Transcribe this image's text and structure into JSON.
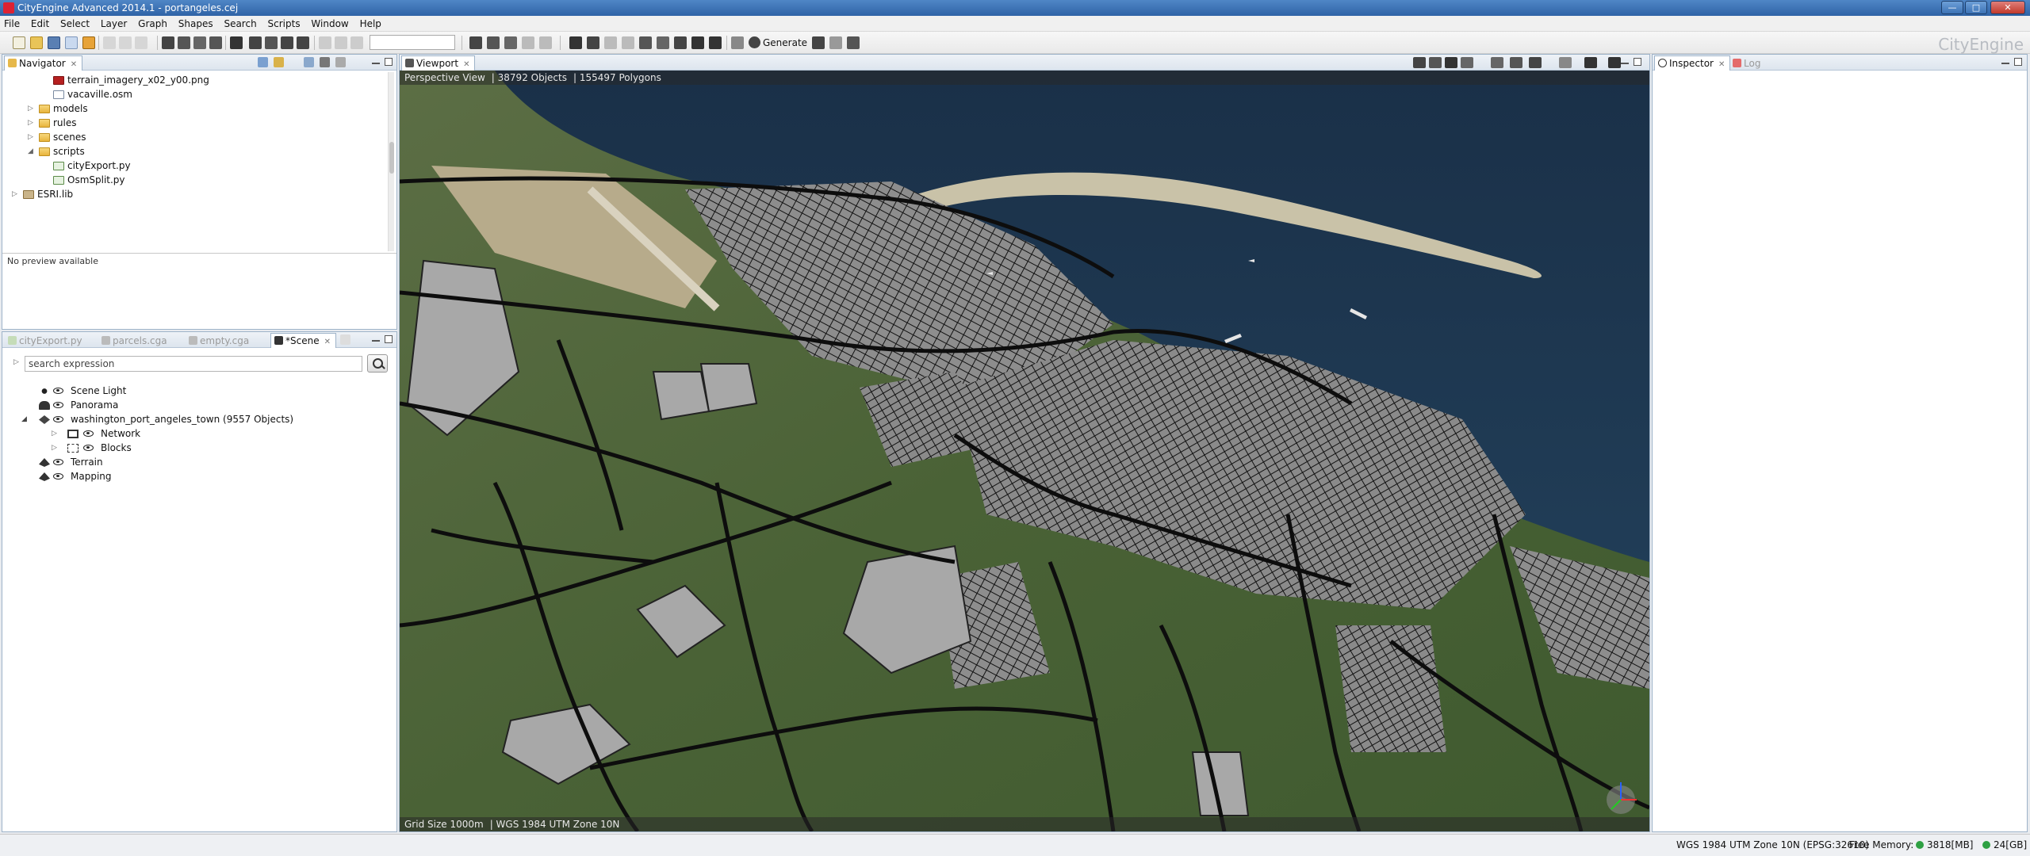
{
  "window": {
    "title": "CityEngine Advanced 2014.1 - portangeles.cej"
  },
  "menu": [
    "File",
    "Edit",
    "Select",
    "Layer",
    "Graph",
    "Shapes",
    "Search",
    "Scripts",
    "Window",
    "Help"
  ],
  "toolbar": {
    "generate_label": "Generate",
    "brand": "CityEngine"
  },
  "navigator": {
    "tab_label": "Navigator",
    "items": [
      {
        "label": "terrain_imagery_x02_y00.png",
        "icon": "image-file-icon"
      },
      {
        "label": "vacaville.osm",
        "icon": "osm-file-icon"
      },
      {
        "label": "models",
        "icon": "folder-icon"
      },
      {
        "label": "rules",
        "icon": "folder-icon"
      },
      {
        "label": "scenes",
        "icon": "folder-icon"
      },
      {
        "label": "scripts",
        "icon": "folder-icon"
      },
      {
        "label": "cityExport.py",
        "icon": "python-file-icon"
      },
      {
        "label": "OsmSplit.py",
        "icon": "python-file-icon"
      },
      {
        "label": "ESRI.lib",
        "icon": "library-icon"
      }
    ],
    "preview_text": "No preview available"
  },
  "editor_tabs": [
    {
      "label": "cityExport.py",
      "active": false
    },
    {
      "label": "parcels.cga",
      "active": false
    },
    {
      "label": "empty.cga",
      "active": false
    },
    {
      "label": "*Scene",
      "active": true
    }
  ],
  "scene": {
    "search_placeholder": "search expression",
    "layers": [
      {
        "label": "Scene Light",
        "icon": "light-icon"
      },
      {
        "label": "Panorama",
        "icon": "panorama-icon"
      },
      {
        "label": "washington_port_angeles_town (9557 Objects)",
        "icon": "graph-layer-icon"
      },
      {
        "label": "Network",
        "icon": "network-icon"
      },
      {
        "label": "Blocks",
        "icon": "blocks-icon"
      },
      {
        "label": "Terrain",
        "icon": "terrain-icon"
      },
      {
        "label": "Mapping",
        "icon": "mapping-icon"
      }
    ]
  },
  "viewport": {
    "tab_label": "Viewport",
    "view_name": "Perspective View",
    "objects": "38792 Objects",
    "polygons": "155497 Polygons",
    "grid_size": "Grid Size 1000m",
    "crs": "WGS 1984 UTM Zone 10N"
  },
  "inspector": {
    "tab_label": "Inspector",
    "log_label": "Log"
  },
  "status": {
    "crs": "WGS 1984 UTM Zone 10N (EPSG:32610)",
    "free_memory_label": "Free Memory:",
    "memory_value": "3818[MB]",
    "disk_value": "24[GB]"
  },
  "colors": {
    "water": "#1f3a55",
    "land": "#4f6a3a",
    "roads": "#111111",
    "blocks": "#9c9c9c",
    "accent": "#2f63a6"
  }
}
